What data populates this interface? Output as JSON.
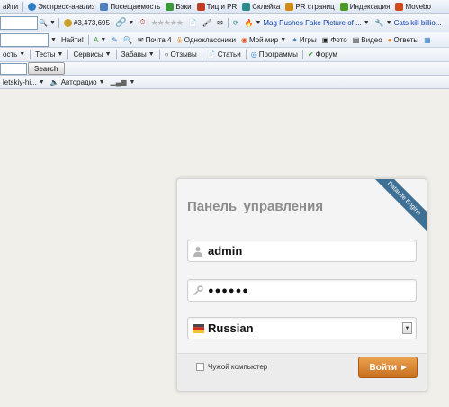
{
  "toolbar1": {
    "items": [
      {
        "label": "айти",
        "icon": "cut-off-item",
        "color": "#1a1a1a"
      },
      {
        "label": "Экспресс-анализ",
        "icon": "globe-icon",
        "color": "#2f7fc6"
      },
      {
        "label": "Посещаемость",
        "icon": "chart-icon",
        "color": "#4f81bd"
      },
      {
        "label": "Бэки",
        "icon": "links-icon",
        "color": "#3c9a3c"
      },
      {
        "label": "Тиц и PR",
        "icon": "rank-icon",
        "color": "#c23b22"
      },
      {
        "label": "Склейка",
        "icon": "merge-icon",
        "color": "#2a8c8c"
      },
      {
        "label": "PR страниц",
        "icon": "pr-icon",
        "color": "#d08b14"
      },
      {
        "label": "Индексация",
        "icon": "index-icon",
        "color": "#4a9a28"
      },
      {
        "label": "Movebo",
        "icon": "movebo-icon",
        "color": "#d04a1a"
      }
    ]
  },
  "toolbar2": {
    "counter": "#3,473,695",
    "news": [
      {
        "label": "Mag Pushes Fake Picture of ..."
      },
      {
        "label": "Cats kill billio..."
      }
    ]
  },
  "toolbar3": {
    "find_label": "Найти!",
    "items": [
      "Почта 4",
      "Одноклассники",
      "Мой мир",
      "Игры",
      "Фото",
      "Видео",
      "Ответы"
    ]
  },
  "toolbar4": {
    "items": [
      "ость",
      "Тесты",
      "Сервисы",
      "Забавы",
      "Отзывы",
      "Статьи",
      "Программы",
      "Форум"
    ]
  },
  "toolbar5": {
    "search_label": "Search",
    "station": "letskiy-hi...",
    "radio": "Авторадио"
  },
  "login_panel": {
    "title": "Панель управления",
    "ribbon": "DataLife Engine",
    "username": "admin",
    "password_mask": "●●●●●●",
    "language": "Russian",
    "remember_label": "Чужой компьютер",
    "login_button": "Войти"
  }
}
